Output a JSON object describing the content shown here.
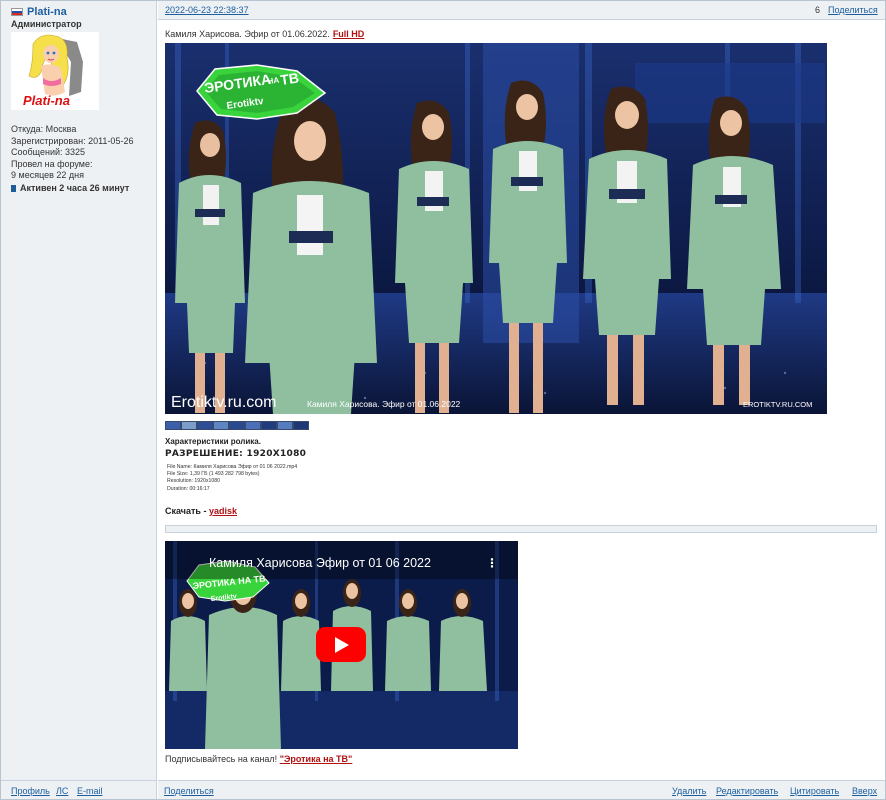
{
  "user": {
    "name": "Plati-na",
    "rank": "Администратор",
    "avatar_caption": "Plati-na",
    "info": [
      "Откуда: Москва",
      "Зарегистрирован: 2011-05-26",
      "Сообщений: 3325",
      "Провел на форуме:",
      "9 месяцев 22 дня"
    ],
    "active": "Активен 2 часа 26 минут"
  },
  "header": {
    "date": "2022-06-23 22:38:37",
    "post_number": "6",
    "share": "Поделиться"
  },
  "post": {
    "title": "Камиля Харисова. Эфир от 01.06.2022.",
    "title_link": "Full HD",
    "image": {
      "logo_top": "ЭРОТИКА",
      "logo_na": "НА",
      "logo_tv": "ТВ",
      "logo_sub": "Erotiktv",
      "watermark_left": "Erotiktv.ru.com",
      "watermark_caption": "Камиля Харисова. Эфир от 01.06.2022",
      "watermark_right": "EROTIKTV.RU.COM"
    },
    "char_title": "Характеристики ролика.",
    "resolution": "РАЗРЕШЕНИЕ: 1920X1080",
    "file_info": [
      "File Name: Камиля Харисова Эфир от 01 06 2022.mp4",
      "File Size: 1,39 ГБ (1 493 282 798 bytes)",
      "Resolution: 1920x1080",
      "Duration: 00:16:17"
    ],
    "download_label": "Скачать -",
    "download_link": "yadisk",
    "video_title": "Камиля Харисова Эфир от 01 06 2022",
    "video_logo_top": "ЭРОТИКА НА ТВ",
    "video_logo_sub": "Erotiktv",
    "subscribe_text": "Подписывайтесь на канал!",
    "subscribe_link": "\"Эротика на ТВ\""
  },
  "footer": {
    "profile": "Профиль",
    "pm": "ЛС",
    "email": "E-mail",
    "share": "Поделиться",
    "delete": "Удалить",
    "edit": "Редактировать",
    "quote": "Цитировать",
    "top": "Вверх"
  },
  "colors": {
    "link": "#1c5e9e",
    "accent_red": "#b01010",
    "panel_bg": "#eef1f4",
    "studio_bg": "#0b1535",
    "suit_green": "#8fbf9f",
    "youtube_red": "#ff0000"
  }
}
